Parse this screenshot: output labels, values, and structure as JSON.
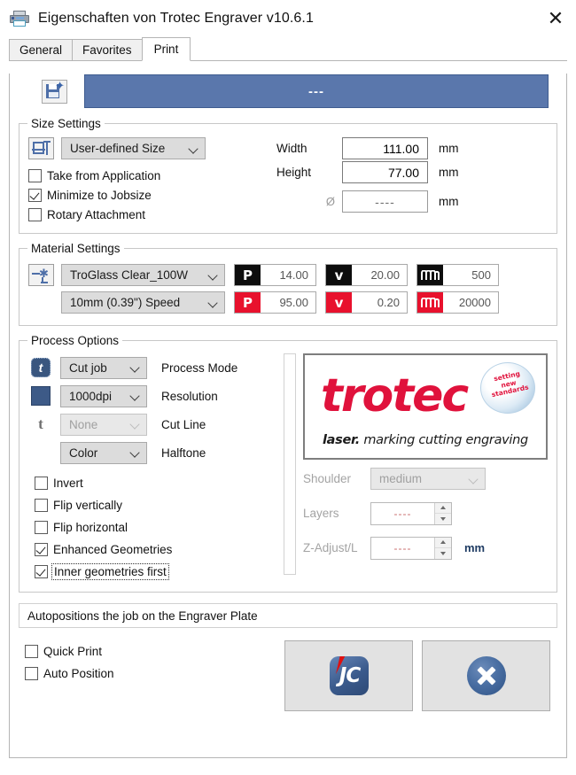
{
  "window": {
    "title": "Eigenschaften von Trotec Engraver v10.6.1",
    "printer_icon": "printer-icon",
    "close_label": "✕"
  },
  "tabs": [
    {
      "label": "General",
      "active": false
    },
    {
      "label": "Favorites",
      "active": false
    },
    {
      "label": "Print",
      "active": true
    }
  ],
  "banner": {
    "save_icon": "save-as-new-icon",
    "value": "---"
  },
  "size_settings": {
    "legend": "Size Settings",
    "icon": "dimensions-icon",
    "size_mode": "User-defined Size",
    "checkboxes": [
      {
        "label": "Take from Application",
        "checked": false
      },
      {
        "label": "Minimize to Jobsize",
        "checked": true
      },
      {
        "label": "Rotary Attachment",
        "checked": false
      }
    ],
    "fields": [
      {
        "label": "Width",
        "value": "111.00",
        "unit": "mm"
      },
      {
        "label": "Height",
        "value": "77.00",
        "unit": "mm"
      }
    ],
    "diameter": {
      "symbol": "Ø",
      "value": "----",
      "unit": "mm"
    }
  },
  "material_settings": {
    "legend": "Material Settings",
    "icon": "laser-material-icon",
    "material": "TroGlass Clear_100W",
    "thickness": "10mm (0.39\") Speed",
    "rows": [
      {
        "accent": "#0d0d0d",
        "power": {
          "badge": "P",
          "value": "14.00"
        },
        "velocity": {
          "badge": "v",
          "value": "20.00"
        },
        "frequency": {
          "badge": "frequency-icon",
          "value": "500"
        }
      },
      {
        "accent": "#e8112d",
        "power": {
          "badge": "P",
          "value": "95.00"
        },
        "velocity": {
          "badge": "v",
          "value": "0.20"
        },
        "frequency": {
          "badge": "frequency-icon",
          "value": "20000"
        }
      }
    ]
  },
  "process_options": {
    "legend": "Process Options",
    "rows": [
      {
        "icon": "process-mode-icon",
        "value": "Cut job",
        "label": "Process Mode",
        "disabled": false
      },
      {
        "icon": "resolution-color-icon",
        "value": "1000dpi",
        "label": "Resolution",
        "disabled": false
      },
      {
        "icon": "cut-line-icon",
        "value": "None",
        "label": "Cut Line",
        "disabled": true
      },
      {
        "icon": "halftone-icon",
        "value": "Color",
        "label": "Halftone",
        "disabled": false
      }
    ],
    "checkboxes": [
      {
        "label": "Invert",
        "checked": false,
        "focused": false
      },
      {
        "label": "Flip vertically",
        "checked": false,
        "focused": false
      },
      {
        "label": "Flip horizontal",
        "checked": false,
        "focused": false
      },
      {
        "label": "Enhanced Geometries",
        "checked": true,
        "focused": false
      },
      {
        "label": "Inner geometries first",
        "checked": true,
        "focused": true
      }
    ],
    "logo": {
      "word": "trotec",
      "registered": "®",
      "tagline_bold": "laser.",
      "tagline": " marking cutting engraving",
      "badge_text": "setting new standards"
    },
    "right_fields": [
      {
        "label": "Shoulder",
        "type": "combo",
        "value": "medium",
        "unit": ""
      },
      {
        "label": "Layers",
        "type": "spin",
        "value": "----",
        "unit": ""
      },
      {
        "label": "Z-Adjust/L",
        "type": "spin",
        "value": "----",
        "unit": "mm"
      }
    ]
  },
  "status": {
    "text": "Autopositions the job on the Engraver Plate"
  },
  "footer": {
    "checkboxes": [
      {
        "label": "Quick Print",
        "checked": false
      },
      {
        "label": "Auto Position",
        "checked": false
      }
    ],
    "buttons": [
      {
        "name": "jobcontrol-button",
        "icon": "jobcontrol-icon",
        "text": "JC"
      },
      {
        "name": "cancel-button",
        "icon": "cancel-x-icon"
      }
    ]
  },
  "colors": {
    "banner_blue": "#5a77ac",
    "trotec_red": "#e0123c",
    "accent_red": "#e8112d",
    "icon_blue": "#3d5a87"
  }
}
